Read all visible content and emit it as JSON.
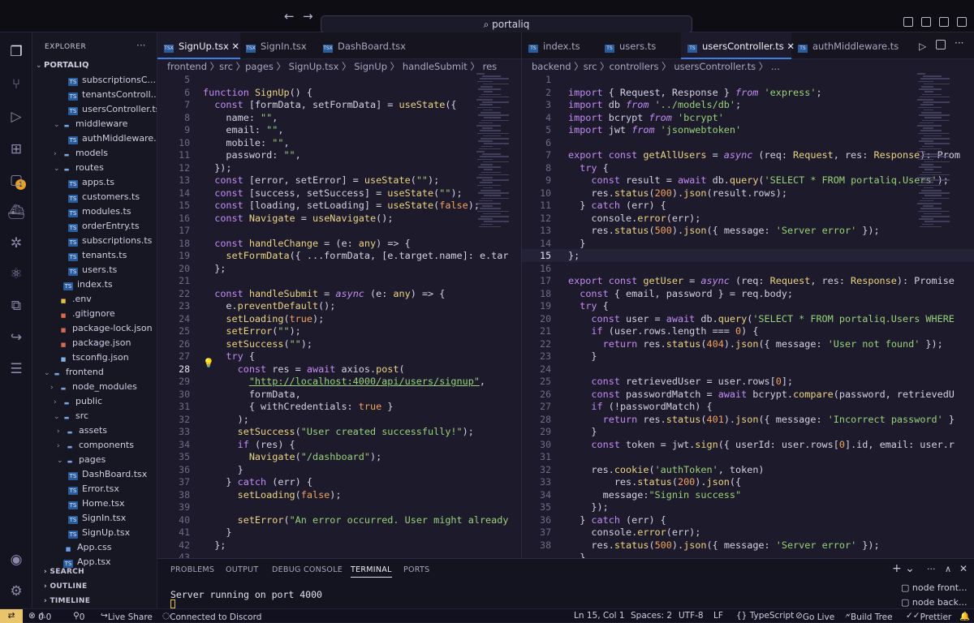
{
  "title_bar": {
    "search": "portaliq",
    "back": "←",
    "forward": "→"
  },
  "explorer": {
    "header": "EXPLORER",
    "root": "PORTALIQ",
    "items": [
      "subscriptionsC...",
      "tenantsControll...",
      "usersController.ts",
      "middleware",
      "authMiddleware...",
      "models",
      "routes",
      "apps.ts",
      "customers.ts",
      "modules.ts",
      "orderEntry.ts",
      "subscriptions.ts",
      "tenants.ts",
      "users.ts",
      "index.ts",
      ".env",
      ".gitignore",
      "package-lock.json",
      "package.json",
      "tsconfig.json",
      "frontend",
      "node_modules",
      "public",
      "src",
      "assets",
      "components",
      "pages",
      "DashBoard.tsx",
      "Error.tsx",
      "Home.tsx",
      "SignIn.tsx",
      "SignUp.tsx",
      "App.css",
      "App.tsx"
    ],
    "sections": [
      "SEARCH",
      "OUTLINE",
      "TIMELINE"
    ]
  },
  "left_editor": {
    "tabs": [
      "SignUp.tsx",
      "SignIn.tsx",
      "DashBoard.tsx"
    ],
    "tab_icons": [
      "TSX",
      "TSX",
      "TSX"
    ],
    "crumbs": "frontend  〉src  〉pages  〉 SignUp.tsx  〉 SignUp  〉 handleSubmit  〉 res"
  },
  "right_editor": {
    "tabs": [
      "index.ts",
      "users.ts",
      "usersController.ts",
      "authMiddleware.ts"
    ],
    "tab_icons": [
      "TS",
      "TS",
      "TS",
      "TS"
    ],
    "crumbs": "backend  〉src  〉controllers  〉 usersController.ts  〉 ..."
  },
  "panel": {
    "tabs": [
      "PROBLEMS",
      "OUTPUT",
      "DEBUG CONSOLE",
      "TERMINAL",
      "PORTS"
    ],
    "terminal_output": "Server running on port 4000",
    "terminals": [
      "node front...",
      "node back..."
    ]
  },
  "status": {
    "errors": "0",
    "warnings": "0",
    "ports": "0",
    "live_share": "Live Share",
    "discord": "Connected to Discord",
    "position": "Ln 15, Col 1",
    "spaces": "Spaces: 2",
    "encoding": "UTF-8",
    "eol": "LF",
    "language": "{} TypeScript",
    "go_live": "Go Live",
    "build_tree": "Build Tree",
    "prettier": "Prettier"
  },
  "colors": {
    "accent": "#3d7fe0",
    "keyword": "#c38cf5",
    "function": "#ecd484",
    "string": "#98d27a",
    "number": "#f2a25e"
  }
}
